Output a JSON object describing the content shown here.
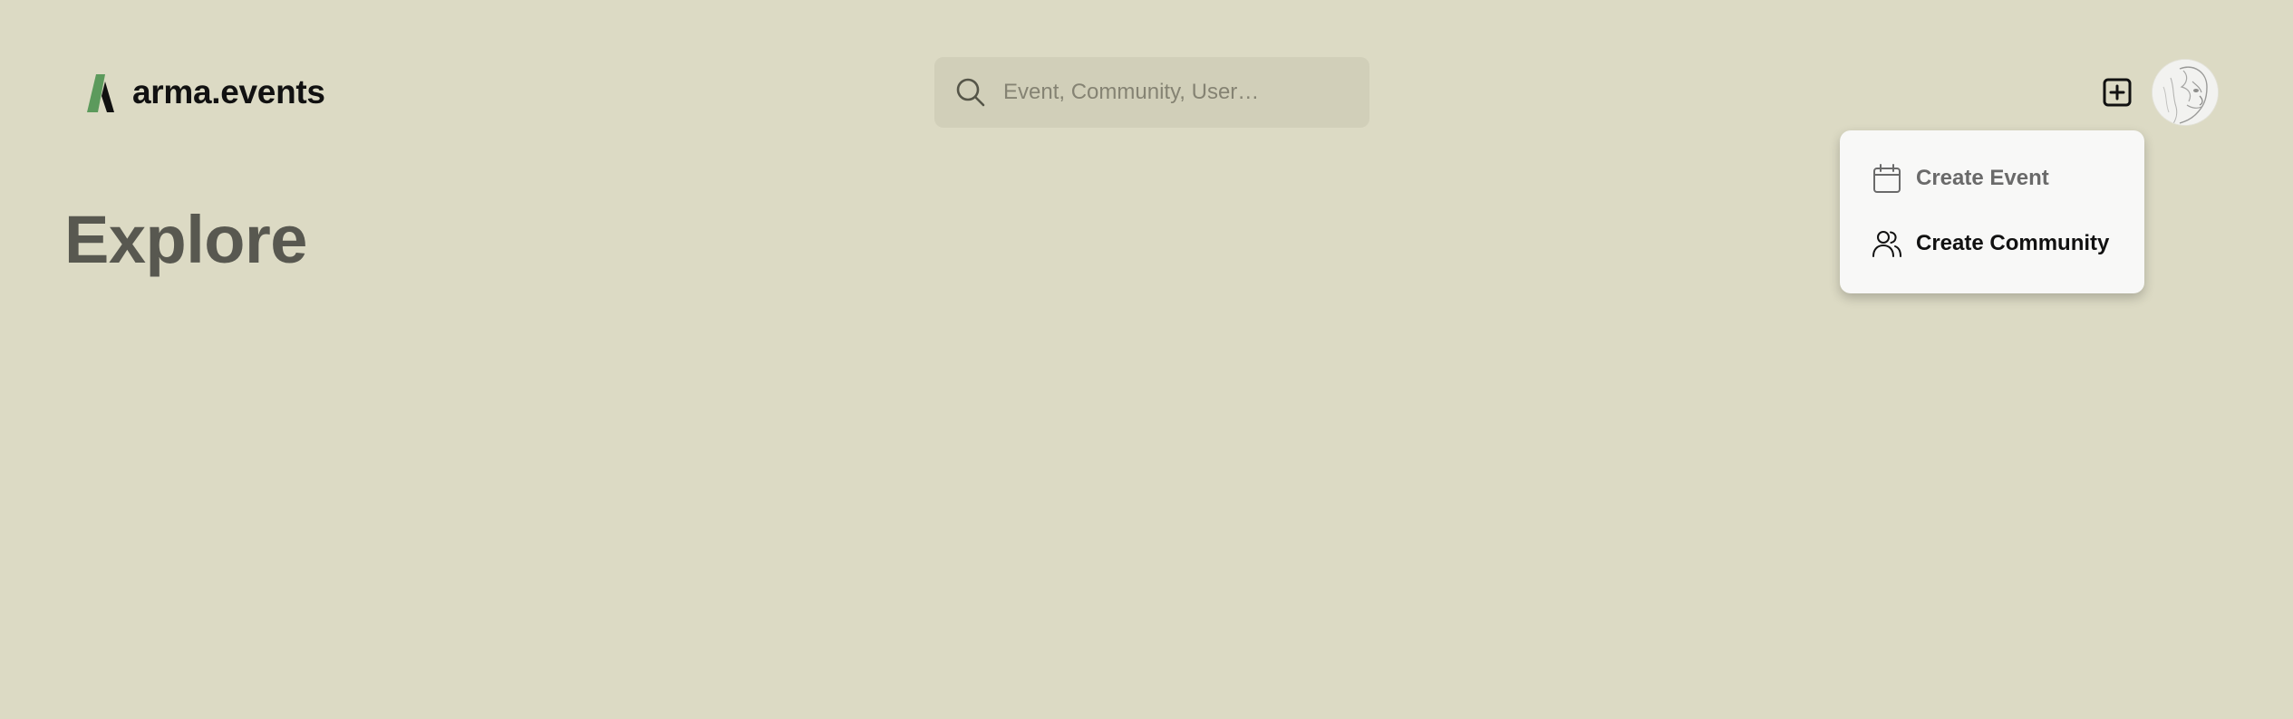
{
  "header": {
    "brand": "arma.events",
    "search": {
      "placeholder": "Event, Community, User…",
      "value": ""
    },
    "create_button_icon": "plus-square-icon",
    "avatar_icon": "user-avatar-sketch"
  },
  "main": {
    "title": "Explore"
  },
  "create_menu": {
    "items": [
      {
        "label": "Create Event",
        "icon": "calendar-icon"
      },
      {
        "label": "Create Community",
        "icon": "users-icon"
      }
    ]
  },
  "colors": {
    "background": "#dcdac4",
    "search_background": "#d1cfb9",
    "brand_green": "#5c9a5c",
    "title": "#585850",
    "menu_background": "#f8f8f7"
  }
}
